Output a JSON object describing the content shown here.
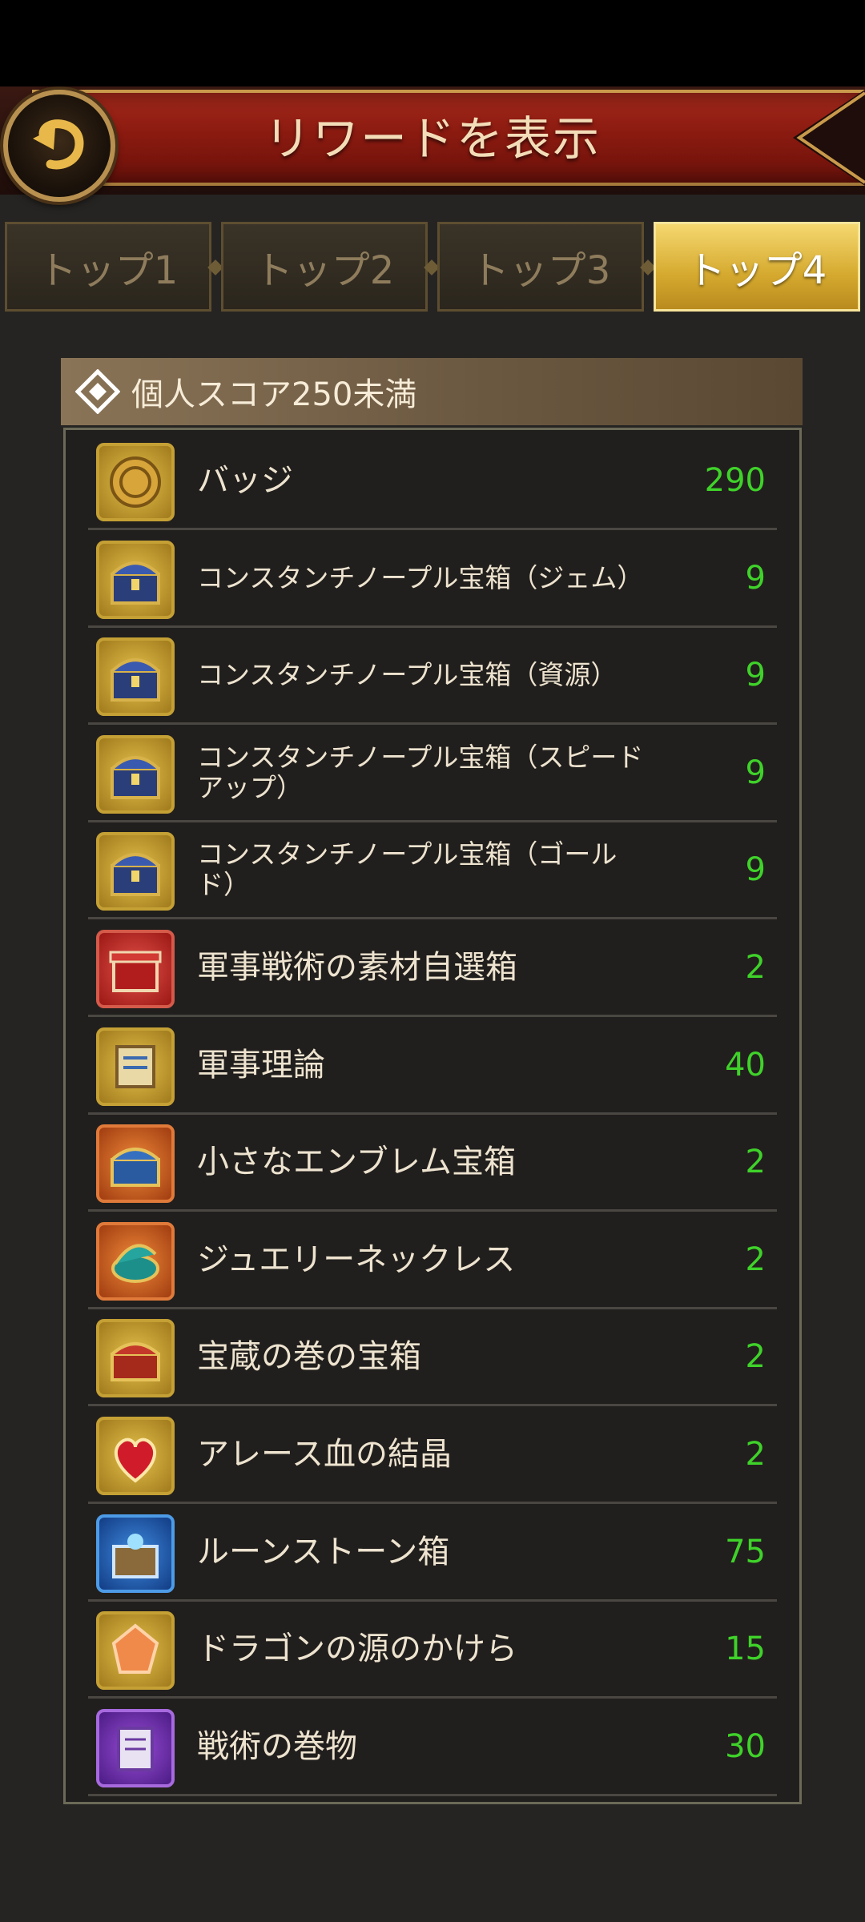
{
  "header": {
    "title": "リワードを表示",
    "back_icon": "back-arrow-icon"
  },
  "tabs": [
    {
      "label": "トップ1",
      "active": false
    },
    {
      "label": "トップ2",
      "active": false
    },
    {
      "label": "トップ3",
      "active": false
    },
    {
      "label": "トップ4",
      "active": true
    }
  ],
  "section": {
    "title": "個人スコア250未満",
    "icon": "diamond-icon"
  },
  "colors": {
    "quantity": "#3fd22a",
    "active_tab": "#d5a92e",
    "banner": "#8a1a10"
  },
  "rewards": [
    {
      "name": "バッジ",
      "qty": "290",
      "icon": "badge-coin-icon"
    },
    {
      "name": "コンスタンチノープル宝箱（ジェム）",
      "qty": "9",
      "icon": "treasure-chest-icon"
    },
    {
      "name": "コンスタンチノープル宝箱（資源）",
      "qty": "9",
      "icon": "treasure-chest-icon"
    },
    {
      "name": "コンスタンチノープル宝箱（スピードアップ）",
      "qty": "9",
      "icon": "treasure-chest-icon"
    },
    {
      "name": "コンスタンチノープル宝箱（ゴールド）",
      "qty": "9",
      "icon": "treasure-chest-icon"
    },
    {
      "name": "軍事戦術の素材自選箱",
      "qty": "2",
      "icon": "red-box-icon"
    },
    {
      "name": "軍事理論",
      "qty": "40",
      "icon": "scroll-icon"
    },
    {
      "name": "小さなエンブレム宝箱",
      "qty": "2",
      "icon": "emblem-chest-icon"
    },
    {
      "name": "ジュエリーネックレス",
      "qty": "2",
      "icon": "jewelry-box-icon"
    },
    {
      "name": "宝蔵の巻の宝箱",
      "qty": "2",
      "icon": "red-chest-icon"
    },
    {
      "name": "アレース血の結晶",
      "qty": "2",
      "icon": "blood-crystal-icon"
    },
    {
      "name": "ルーンストーン箱",
      "qty": "75",
      "icon": "runestone-box-icon"
    },
    {
      "name": "ドラゴンの源のかけら",
      "qty": "15",
      "icon": "dragon-shard-icon"
    },
    {
      "name": "戦術の巻物",
      "qty": "30",
      "icon": "tactics-scroll-icon"
    }
  ]
}
